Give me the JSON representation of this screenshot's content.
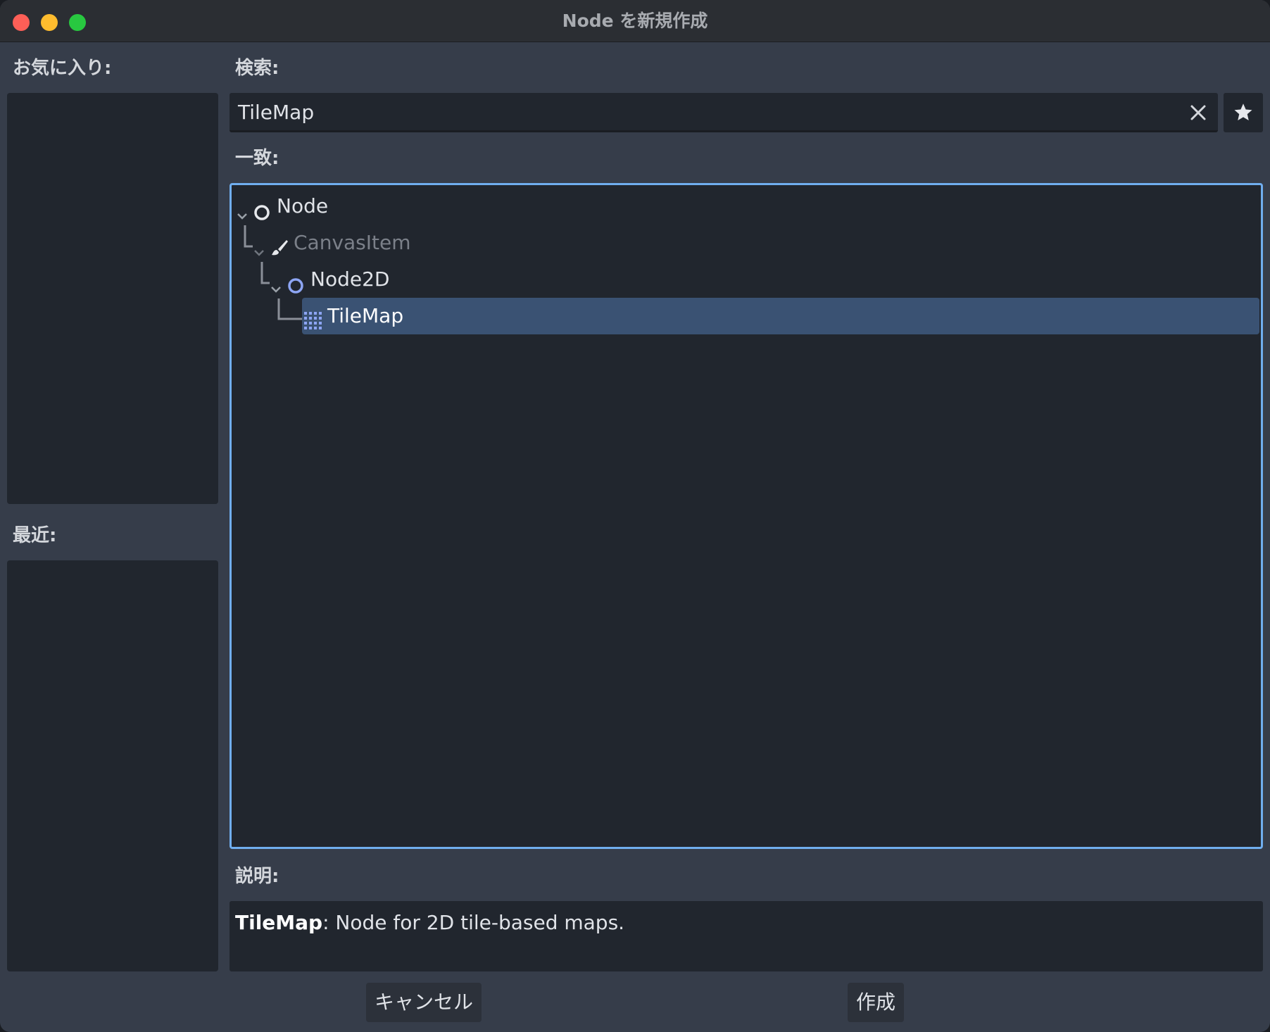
{
  "window": {
    "title": "Node を新規作成"
  },
  "sidebar": {
    "favorites_label": "お気に入り:",
    "recent_label": "最近:"
  },
  "search": {
    "label": "検索:",
    "value": "TileMap",
    "clear_icon": "close-icon",
    "favorite_icon": "star-icon"
  },
  "matches": {
    "label": "一致:",
    "items": [
      {
        "label": "Node",
        "icon": "node-circle-icon",
        "expanded": true,
        "selected": false
      },
      {
        "label": "CanvasItem",
        "icon": "brush-icon",
        "expanded": true,
        "selected": false,
        "disabled": true
      },
      {
        "label": "Node2D",
        "icon": "node2d-circle-icon",
        "expanded": true,
        "selected": false
      },
      {
        "label": "TileMap",
        "icon": "tilemap-grid-icon",
        "expanded": false,
        "selected": true
      }
    ]
  },
  "description": {
    "label": "説明:",
    "name": "TileMap",
    "separator": ":",
    "text": " Node for 2D tile-based maps."
  },
  "buttons": {
    "cancel": "キャンセル",
    "create": "作成"
  },
  "colors": {
    "window_bg": "#363d4a",
    "panel_bg": "#21262e",
    "accent_border": "#70aeef",
    "selection": "#3a5273",
    "node2d_icon": "#8da5f3"
  }
}
